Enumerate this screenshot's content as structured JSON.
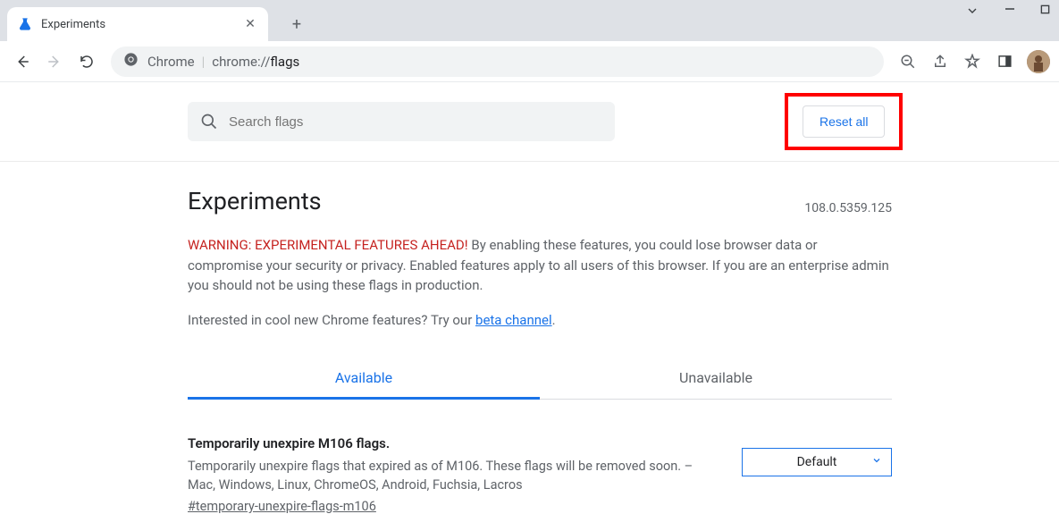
{
  "browser": {
    "tab_title": "Experiments",
    "omnibox_scheme": "Chrome",
    "omnibox_url_prefix": "chrome://",
    "omnibox_url_path": "flags"
  },
  "search": {
    "placeholder": "Search flags"
  },
  "reset_label": "Reset all",
  "page_title": "Experiments",
  "version": "108.0.5359.125",
  "warning_label": "WARNING: EXPERIMENTAL FEATURES AHEAD!",
  "warning_body": " By enabling these features, you could lose browser data or compromise your security or privacy. Enabled features apply to all users of this browser. If you are an enterprise admin you should not be using these flags in production.",
  "interest_pre": "Interested in cool new Chrome features? Try our ",
  "interest_link": "beta channel",
  "interest_post": ".",
  "tabs": {
    "available": "Available",
    "unavailable": "Unavailable"
  },
  "flag": {
    "title": "Temporarily unexpire M106 flags.",
    "desc": "Temporarily unexpire flags that expired as of M106. These flags will be removed soon. – Mac, Windows, Linux, ChromeOS, Android, Fuchsia, Lacros",
    "hash": "#temporary-unexpire-flags-m106",
    "selected": "Default"
  }
}
